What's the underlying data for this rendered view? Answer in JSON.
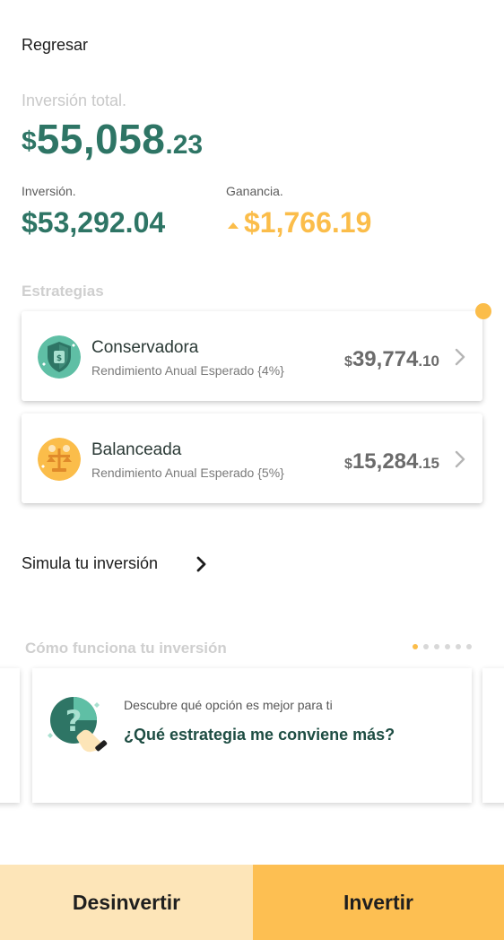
{
  "header": {
    "back_label": "Regresar"
  },
  "summary": {
    "total_label": "Inversión total.",
    "total_currency": "$",
    "total_integer": "55,058",
    "total_decimal": ".23",
    "investment_label": "Inversión.",
    "investment_value": "$53,292.04",
    "gain_label": "Ganancia.",
    "gain_value": "$1,766.19"
  },
  "strategies": {
    "title": "Estrategias",
    "items": [
      {
        "name": "Conservadora",
        "subtitle": "Rendimiento Anual Esperado {4%}",
        "currency": "$",
        "integer": "39,774",
        "decimal": ".10",
        "icon": "shield-money-icon",
        "icon_color": "#5fbfa5"
      },
      {
        "name": "Balanceada",
        "subtitle": "Rendimiento Anual Esperado {5%}",
        "currency": "$",
        "integer": "15,284",
        "decimal": ".15",
        "icon": "balance-scale-icon",
        "icon_color": "#fbbd4a"
      }
    ]
  },
  "simulate": {
    "label": "Simula tu inversión"
  },
  "how_it_works": {
    "title": "Cómo funciona tu inversión",
    "page_count": 6,
    "active_page": 1,
    "cards": [
      {
        "subtitle": "Descubre qué opción es mejor para ti",
        "title": "¿Qué estrategia me conviene más?",
        "icon": "question-hand-icon"
      }
    ]
  },
  "actions": {
    "divest_label": "Desinvertir",
    "invest_label": "Invertir"
  },
  "colors": {
    "primary_green": "#2e7565",
    "accent_yellow": "#fbbd4a",
    "divest_bg": "#fde5b8",
    "invest_bg": "#fdbf52"
  }
}
